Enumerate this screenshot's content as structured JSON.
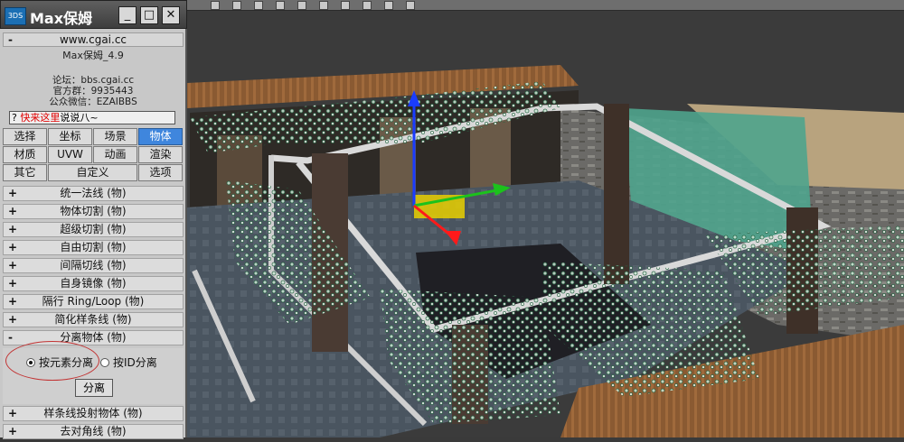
{
  "app": {
    "title": "Max保姆",
    "logo_icon": "3dsmax-logo-icon",
    "window_buttons": [
      "minimize-icon",
      "maximize-icon",
      "close-icon"
    ]
  },
  "header": {
    "site": "www.cgai.cc",
    "version": "Max保姆_4.9",
    "forum": "论坛：bbs.cgai.cc",
    "group": "官方群：9935443",
    "wechat": "公众微信：EZAIBBS",
    "tip_prefix": "?",
    "tip_red": "快来这里",
    "tip_rest": "说说八~"
  },
  "tabs": [
    {
      "label": "选择",
      "active": false
    },
    {
      "label": "坐标",
      "active": false
    },
    {
      "label": "场景",
      "active": false
    },
    {
      "label": "物体",
      "active": true
    },
    {
      "label": "材质",
      "active": false
    },
    {
      "label": "UVW",
      "active": false
    },
    {
      "label": "动画",
      "active": false
    },
    {
      "label": "渲染",
      "active": false
    },
    {
      "label": "其它",
      "active": false
    },
    {
      "label": "自定义",
      "active": false
    },
    {
      "label": "选项",
      "active": false
    }
  ],
  "rollouts": {
    "items_before": [
      {
        "toggle": "+",
        "label": "统一法线 (物)"
      },
      {
        "toggle": "+",
        "label": "物体切割 (物)"
      },
      {
        "toggle": "+",
        "label": "超级切割 (物)"
      },
      {
        "toggle": "+",
        "label": "自由切割 (物)"
      },
      {
        "toggle": "+",
        "label": "间隔切线 (物)"
      },
      {
        "toggle": "+",
        "label": "自身镜像 (物)"
      },
      {
        "toggle": "+",
        "label": "隔行 Ring/Loop (物)"
      },
      {
        "toggle": "+",
        "label": "简化样条线 (物)"
      }
    ],
    "expanded": {
      "toggle": "-",
      "label": "分离物体 (物)",
      "option_element": "按元素分离",
      "option_id": "按ID分离",
      "selected_option": "按元素分离",
      "button": "分离"
    },
    "items_after": [
      {
        "toggle": "+",
        "label": "样条线投射物体 (物)"
      },
      {
        "toggle": "+",
        "label": "去对角线 (物)"
      }
    ]
  },
  "colors": {
    "panel_bg": "#c8c8c8",
    "active_tab": "#3f86dd",
    "highlight_oval": "#c23333",
    "viewport_bg": "#3a3a3a"
  }
}
